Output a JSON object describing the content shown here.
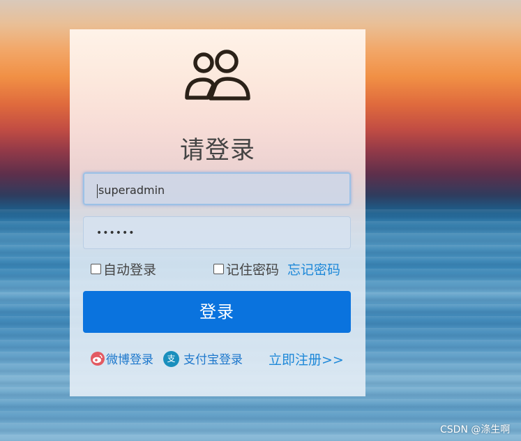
{
  "login": {
    "title": "请登录",
    "username_value": "superadmin",
    "password_masked": "••••••",
    "auto_login_label": "自动登录",
    "remember_password_label": "记住密码",
    "forgot_password_link": "忘记密码",
    "login_button": "登录",
    "weibo_login_label": "微博登录",
    "alipay_login_label": "支付宝登录",
    "alipay_icon_glyph": "支",
    "register_link": "立即注册>>"
  },
  "watermark": "CSDN @涤生啊",
  "icons": {
    "user_group": "users-icon",
    "weibo": "weibo-icon",
    "alipay": "alipay-icon"
  },
  "colors": {
    "primary_button": "#0a73de",
    "link": "#1e88d8",
    "weibo": "#e35a62",
    "alipay": "#1a8fbd"
  }
}
